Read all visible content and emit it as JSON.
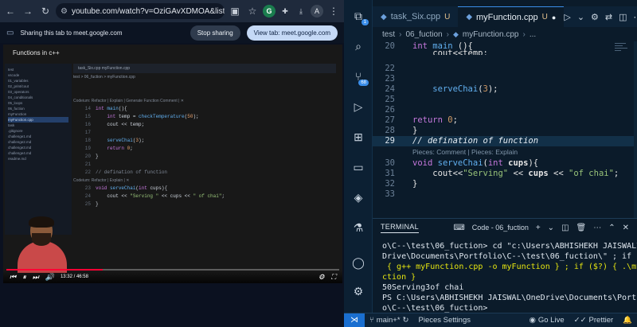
{
  "browser": {
    "url": "youtube.com/watch?v=OziGAvXDMOA&list=PLu71SKx...",
    "avatar_initial": "A",
    "share_text": "Sharing this tab to meet.google.com",
    "stop_label": "Stop sharing",
    "view_label": "View tab: meet.google.com"
  },
  "video": {
    "title": "Functions in c++",
    "tabs": "task_Six.cpp    myFunction.cpp",
    "breadcrumb": "test > 06_fuction > myFunction.cpp",
    "files": [
      "test",
      "vscode",
      "01_variables",
      "02_print/cout",
      "03_operators",
      "04_conditionals",
      "05_loops",
      "06_fuction",
      "myFunction",
      "myFunction.cpp",
      "task",
      ".gitignore",
      "challenge1.md",
      "challenge2.md",
      "challenge3.md",
      "challenge4.md",
      "readme.md"
    ],
    "hint1": "Codeium: Refactor | Explain | Generate Function Comment | ✕",
    "hint2": "Codeium: Refactor | Explain | ✕",
    "time": "13:32 / 46:58",
    "progress_fraction": 0.29
  },
  "vscode": {
    "tabs": [
      {
        "label": "task_Six.cpp",
        "status": "U"
      },
      {
        "label": "myFunction.cpp",
        "status": "U"
      }
    ],
    "breadcrumb": [
      "test",
      "06_fuction",
      "myFunction.cpp",
      "..."
    ],
    "editor_lines": [
      {
        "n": "20"
      },
      {
        "n": "21"
      },
      {
        "n": "22"
      },
      {
        "n": "23"
      },
      {
        "n": "24"
      },
      {
        "n": "25"
      },
      {
        "n": "26"
      },
      {
        "n": "27"
      },
      {
        "n": "28"
      },
      {
        "n": "29"
      },
      {
        "n": "30"
      },
      {
        "n": "31"
      },
      {
        "n": "32"
      },
      {
        "n": "33"
      }
    ],
    "lens": "Pieces: Comment | Pieces: Explain",
    "panel_tab": "TERMINAL",
    "terminal_name": "Code - 06_fuction",
    "terminal_lines": [
      "o\\C--\\test\\06_fuction> cd \"c:\\Users\\ABHISHEKH JAISWAL\\One",
      "Drive\\Documents\\Portfolio\\C--\\test\\06_fuction\\\" ; if ($?)",
      " { g++ myFunction.cpp -o myFunction } ; if ($?) { .\\myFun",
      "ction }",
      "50Serving3of chai",
      "PS C:\\Users\\ABHISHEKH JAISWAL\\OneDrive\\Documents\\Portfoli",
      "o\\C--\\test\\06_fuction>"
    ],
    "status": {
      "branch": "main+*",
      "pieces": "Pieces Settings",
      "golive": "Go Live",
      "prettier": "Prettier"
    }
  }
}
